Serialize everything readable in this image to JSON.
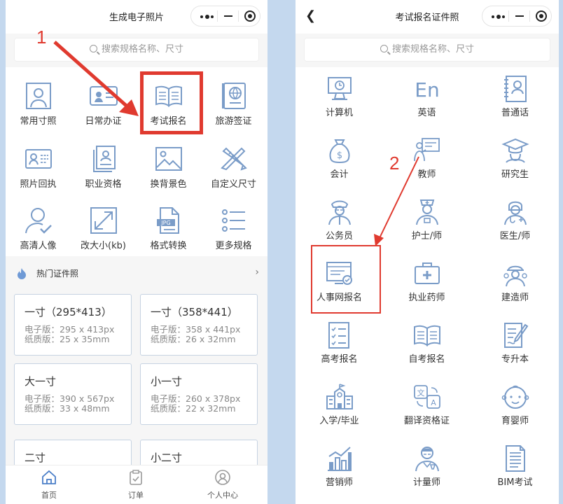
{
  "left": {
    "title": "生成电子照片",
    "search_placeholder": "搜索规格名称、尺寸",
    "categories": [
      {
        "label": "常用寸照",
        "icon": "portrait-photo-icon"
      },
      {
        "label": "日常办证",
        "icon": "id-card-icon"
      },
      {
        "label": "考试报名",
        "icon": "open-book-icon"
      },
      {
        "label": "旅游签证",
        "icon": "passport-globe-icon"
      },
      {
        "label": "照片回执",
        "icon": "receipt-card-icon"
      },
      {
        "label": "职业资格",
        "icon": "certificate-stack-icon"
      },
      {
        "label": "换背景色",
        "icon": "landscape-image-icon"
      },
      {
        "label": "自定义尺寸",
        "icon": "pencil-ruler-icon"
      },
      {
        "label": "高清人像",
        "icon": "person-check-icon"
      },
      {
        "label": "改大小(kb)",
        "icon": "resize-arrows-icon"
      },
      {
        "label": "格式转换",
        "icon": "jpg-file-icon"
      },
      {
        "label": "更多规格",
        "icon": "list-icon"
      }
    ],
    "hot_title": "热门证件照",
    "cards": [
      {
        "name": "一寸（295*413）",
        "e": "电子版：295 x 413px",
        "p": "纸质版：25 x 35mm"
      },
      {
        "name": "一寸（358*441）",
        "e": "电子版：358 x 441px",
        "p": "纸质版：26 x 32mm"
      },
      {
        "name": "大一寸",
        "e": "电子版：390 x 567px",
        "p": "纸质版：33 x 48mm"
      },
      {
        "name": "小一寸",
        "e": "电子版：260 x 378px",
        "p": "纸质版：22 x 32mm"
      },
      {
        "name": "二寸",
        "e": "",
        "p": ""
      },
      {
        "name": "小二寸",
        "e": "",
        "p": ""
      }
    ],
    "tabs": [
      {
        "label": "首页",
        "icon": "home-icon"
      },
      {
        "label": "订单",
        "icon": "clipboard-icon"
      },
      {
        "label": "个人中心",
        "icon": "user-circle-icon"
      }
    ],
    "marker": "1"
  },
  "right": {
    "title": "考试报名证件照",
    "search_placeholder": "搜索规格名称、尺寸",
    "items": [
      {
        "label": "计算机",
        "icon": "computer-icon"
      },
      {
        "label": "英语",
        "icon": "en-letters-icon"
      },
      {
        "label": "普通话",
        "icon": "person-book-icon"
      },
      {
        "label": "会计",
        "icon": "money-bag-icon"
      },
      {
        "label": "教师",
        "icon": "teacher-board-icon"
      },
      {
        "label": "研究生",
        "icon": "graduate-cap-icon"
      },
      {
        "label": "公务员",
        "icon": "officer-icon"
      },
      {
        "label": "护士/师",
        "icon": "nurse-icon"
      },
      {
        "label": "医生/师",
        "icon": "doctor-icon"
      },
      {
        "label": "人事网报名",
        "icon": "monitor-check-icon"
      },
      {
        "label": "执业药师",
        "icon": "medical-kit-icon"
      },
      {
        "label": "建造师",
        "icon": "hardhat-worker-icon"
      },
      {
        "label": "高考报名",
        "icon": "checklist-icon"
      },
      {
        "label": "自考报名",
        "icon": "open-book-icon"
      },
      {
        "label": "专升本",
        "icon": "paper-pen-icon"
      },
      {
        "label": "入学/毕业",
        "icon": "school-building-icon"
      },
      {
        "label": "翻译资格证",
        "icon": "translate-icon"
      },
      {
        "label": "育婴师",
        "icon": "baby-face-icon"
      },
      {
        "label": "营销师",
        "icon": "bar-chart-icon"
      },
      {
        "label": "计量师",
        "icon": "scientist-icon"
      },
      {
        "label": "BIM考试",
        "icon": "document-lines-icon"
      }
    ],
    "marker": "2"
  },
  "colors": {
    "accent": "#e03a2f",
    "icon": "#7a9cc8",
    "border": "#c6d3e2"
  }
}
